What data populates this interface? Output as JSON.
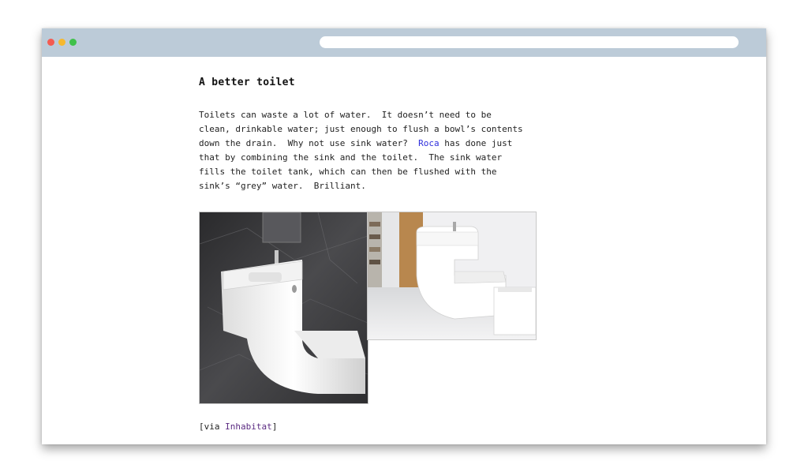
{
  "browser": {
    "url": ""
  },
  "article": {
    "title": "A better toilet",
    "paragraph_before_link": "Toilets can waste a lot of water.  It doesn’t need to be\nclean, drinkable water; just enough to flush a bowl’s contents\ndown the drain.  Why not use sink water?  ",
    "link_text": "Roca",
    "paragraph_after_link": " has done just\nthat by combining the sink and the toilet.  The sink water\nfills the toilet tank, which can then be flushed with the\nsink’s “grey” water.  Brilliant.",
    "via_prefix": "[via ",
    "via_link": "Inhabitat",
    "via_suffix": "]"
  },
  "images": [
    {
      "name": "sink-toilet-dark-photo"
    },
    {
      "name": "sink-toilet-bright-photo"
    }
  ],
  "colors": {
    "titlebar": "#bccbd8",
    "link": "#2f2fdc",
    "visited_link": "#5b2b82",
    "close_dot": "#f45b51",
    "minimize_dot": "#f6b82e",
    "zoom_dot": "#3fc14a"
  }
}
